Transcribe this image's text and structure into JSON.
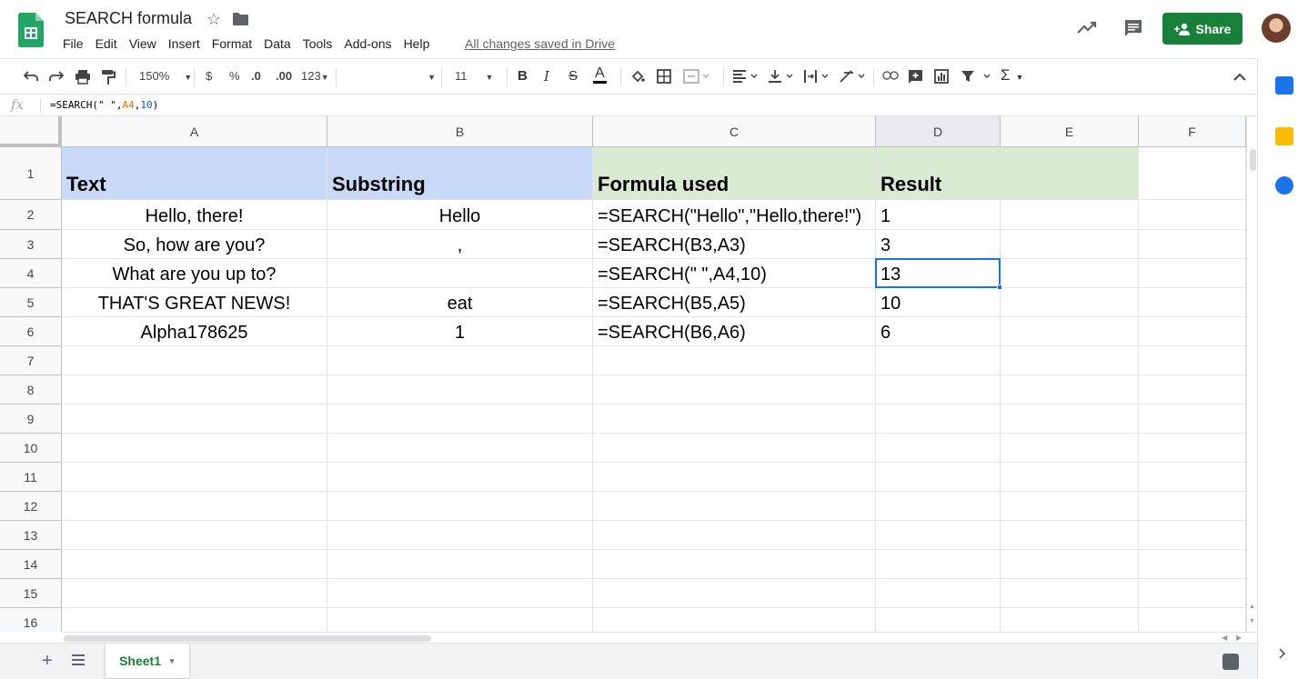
{
  "header": {
    "title": "SEARCH formula",
    "menu": [
      "File",
      "Edit",
      "View",
      "Insert",
      "Format",
      "Data",
      "Tools",
      "Add-ons",
      "Help"
    ],
    "saved_status": "All changes saved in Drive",
    "share_label": "Share"
  },
  "toolbar": {
    "zoom": "150%",
    "currency": "$",
    "percent": "%",
    "decrease_decimals": ".0",
    "increase_decimals": ".00",
    "more_formats": "123",
    "font_size": "11",
    "bold": "B",
    "italic": "I",
    "strikethrough": "S",
    "text_color": "A",
    "sum": "Σ"
  },
  "formula_bar": {
    "fx": "fx",
    "formula_prefix": "=SEARCH(\" \",",
    "ref_a4": "A4",
    "comma": ",",
    "ref_10": "10",
    "formula_suffix": ")"
  },
  "columns": [
    "A",
    "B",
    "C",
    "D",
    "E",
    "F"
  ],
  "rows": [
    "1",
    "2",
    "3",
    "4",
    "5",
    "6",
    "7",
    "8",
    "9",
    "10",
    "11",
    "12",
    "13",
    "14",
    "15",
    "16"
  ],
  "cells": {
    "A1": "Text",
    "B1": "Substring",
    "C1": "Formula used",
    "D1": "Result",
    "A2": "Hello, there!",
    "B2": "Hello",
    "C2": "=SEARCH(\"Hello\",\"Hello,there!\")",
    "D2": "1",
    "A3": "So, how are you?",
    "B3": ",",
    "C3": "=SEARCH(B3,A3)",
    "D3": "3",
    "A4": "What are you up to?",
    "B4": "",
    "C4": "=SEARCH(\" \",A4,10)",
    "D4": "13",
    "A5": "THAT'S GREAT NEWS!",
    "B5": "eat",
    "C5": "=SEARCH(B5,A5)",
    "D5": "10",
    "A6": "Alpha178625",
    "B6": "1",
    "C6": "=SEARCH(B6,A6)",
    "D6": "6"
  },
  "sheet_tab": "Sheet1",
  "colors": {
    "header_blue": "#c9daf8",
    "header_green": "#d9ead3",
    "accent_green": "#188038",
    "selection_blue": "#1a73e8"
  }
}
